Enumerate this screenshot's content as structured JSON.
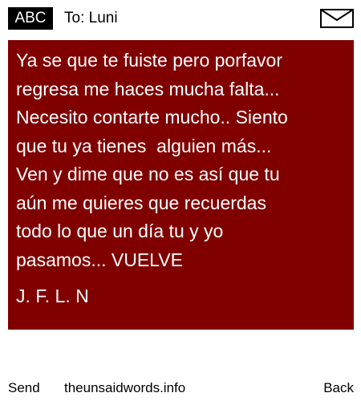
{
  "header": {
    "badge": "ABC",
    "recipient": "To: Luni",
    "icon": "envelope-icon"
  },
  "message": {
    "body": "Ya se que te fuiste pero porfavor\nregresa me haces mucha falta...\nNecesito contarte mucho.. Siento\nque tu ya tienes  alguien más...\nVen y dime que no es así que tu\naún me quieres que recuerdas\ntodo lo que un día tu y yo\npasamos... VUELVE",
    "signature": "J. F. L. N",
    "background_color": "#800000",
    "text_color": "#ffffff"
  },
  "footer": {
    "send_label": "Send",
    "site_label": "theunsaidwords.info",
    "back_label": "Back"
  }
}
